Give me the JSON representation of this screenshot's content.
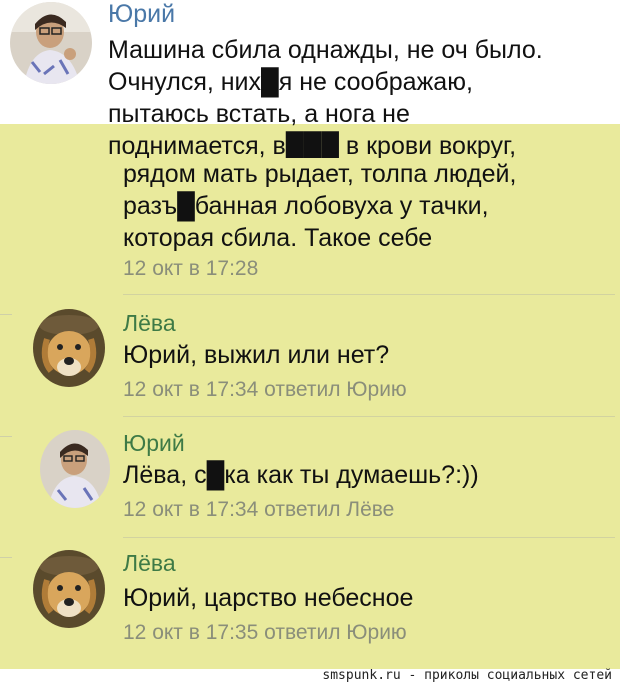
{
  "posts": [
    {
      "author": "Юрий",
      "lines": [
        "Машина сбила однажды, не оч было.",
        "Очнулся, них█я не соображаю,",
        "пытаюсь встать, а нога не",
        "поднимается, в███ в крови вокруг,",
        "рядом мать рыдает, толпа людей,",
        "разъ█банная лобовуха у тачки,",
        "которая сбила. Такое себе"
      ],
      "meta": "12 окт в 17:28"
    },
    {
      "author": "Лёва",
      "text": "Юрий, выжил или нет?",
      "meta": "12 окт в 17:34 ответил Юрию"
    },
    {
      "author": "Юрий",
      "text": "Лёва, с█ка как ты думаешь?:))",
      "meta": "12 окт в 17:34 ответил Лёве"
    },
    {
      "author": "Лёва",
      "text": "Юрий, царство небесное",
      "meta": "12 окт в 17:35 ответил Юрию"
    }
  ],
  "footer": "smspunk.ru - приколы социальных сетей",
  "colors": {
    "background_highlight": "#e9ea9c",
    "name_yuri": "#4a78a8",
    "name_reply": "#3e7a46",
    "meta": "#8a8e7a"
  }
}
